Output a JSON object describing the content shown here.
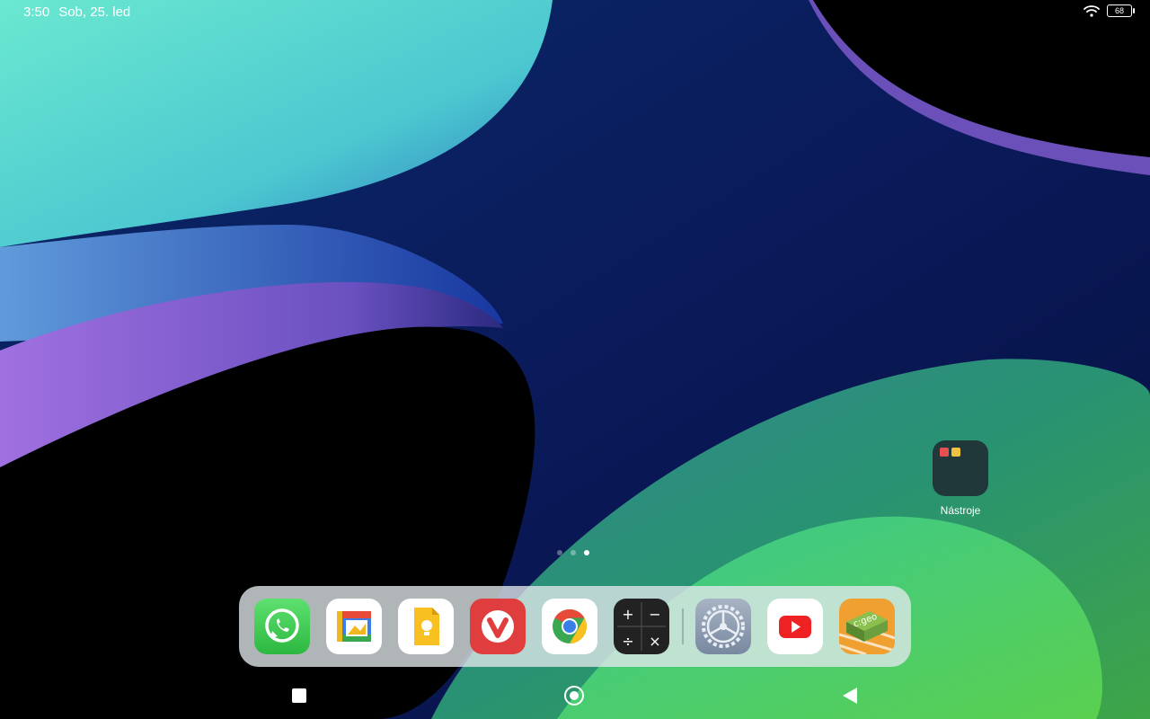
{
  "status": {
    "time": "3:50",
    "date": "Sob, 25. led",
    "battery": "68",
    "wifi_icon": "wifi-icon"
  },
  "home": {
    "folder": {
      "label": "Nástroje",
      "contents": [
        "app-icon-red",
        "app-icon-yellow"
      ]
    },
    "pages": {
      "count": 3,
      "active_index": 2
    }
  },
  "dock": {
    "apps": [
      {
        "name": "whatsapp",
        "icon": "whatsapp-icon"
      },
      {
        "name": "gallery",
        "icon": "gallery-icon"
      },
      {
        "name": "keep-notes",
        "icon": "keep-icon"
      },
      {
        "name": "vivaldi",
        "icon": "vivaldi-icon"
      },
      {
        "name": "chrome",
        "icon": "chrome-icon"
      },
      {
        "name": "calculator",
        "icon": "calculator-icon"
      },
      {
        "name": "settings",
        "icon": "settings-icon"
      },
      {
        "name": "youtube",
        "icon": "youtube-icon"
      },
      {
        "name": "c:geo",
        "icon": "cgeo-icon",
        "text": "c:geo"
      }
    ]
  },
  "navigation": {
    "recents": "recents-square-icon",
    "home": "home-circle-icon",
    "back": "back-triangle-icon"
  },
  "colors": {
    "wallpaper_base": "#0a1a52",
    "teal": "#4fd8c8",
    "purple": "#9070d8",
    "green": "#3cb860"
  }
}
